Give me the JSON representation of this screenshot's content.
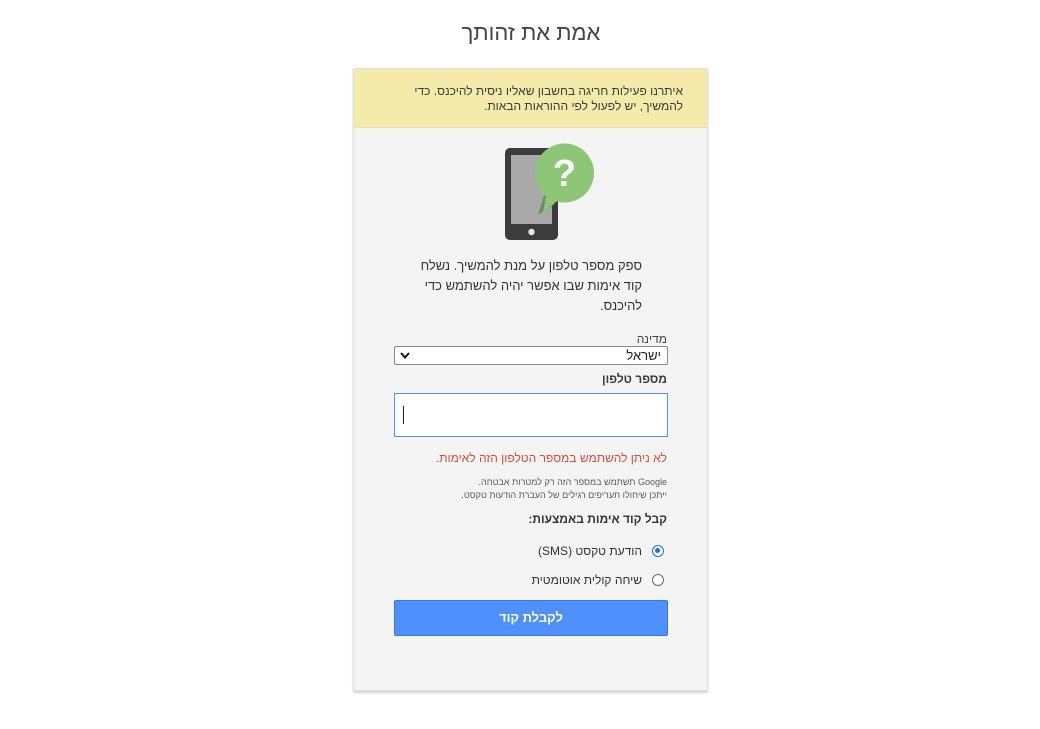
{
  "page": {
    "title": "אמת את זהותך"
  },
  "notice": {
    "text": "איתרנו פעילות חריגה בחשבון שאליו ניסית להיכנס. כדי להמשיך, יש לפעול לפי ההוראות הבאות."
  },
  "instructions": {
    "text": "ספק מספר טלפון על מנת להמשיך. נשלח קוד אימות שבו אפשר יהיה להשתמש כדי להיכנס."
  },
  "country": {
    "label": "מדינה",
    "selected": "ישראל"
  },
  "phone": {
    "label": "מספר טלפון",
    "value": ""
  },
  "error": {
    "text": "לא ניתן להשתמש במספר הטלפון הזה לאימות."
  },
  "disclaimer": {
    "line1": "Google תשתמש במספר הזה רק למטרות אבטחה.",
    "line2": "ייתכן שיחולו תעריפים רגילים של העברת הודעות טקסט."
  },
  "method": {
    "heading": "קבל קוד אימות באמצעות:",
    "options": [
      {
        "label": "הודעת טקסט (SMS)",
        "checked": true
      },
      {
        "label": "שיחה קולית אוטומטית",
        "checked": false
      }
    ]
  },
  "submit": {
    "label": "לקבלת קוד"
  },
  "colors": {
    "accent": "#4d90fe",
    "notice_bg": "#f4eaaa",
    "error": "#dd4b39",
    "illustration_green": "#8cc676",
    "phone_body": "#3c3c3c"
  },
  "icons": {
    "illustration": "phone-question-illustration",
    "select_chevron": "chevron-down-icon"
  }
}
